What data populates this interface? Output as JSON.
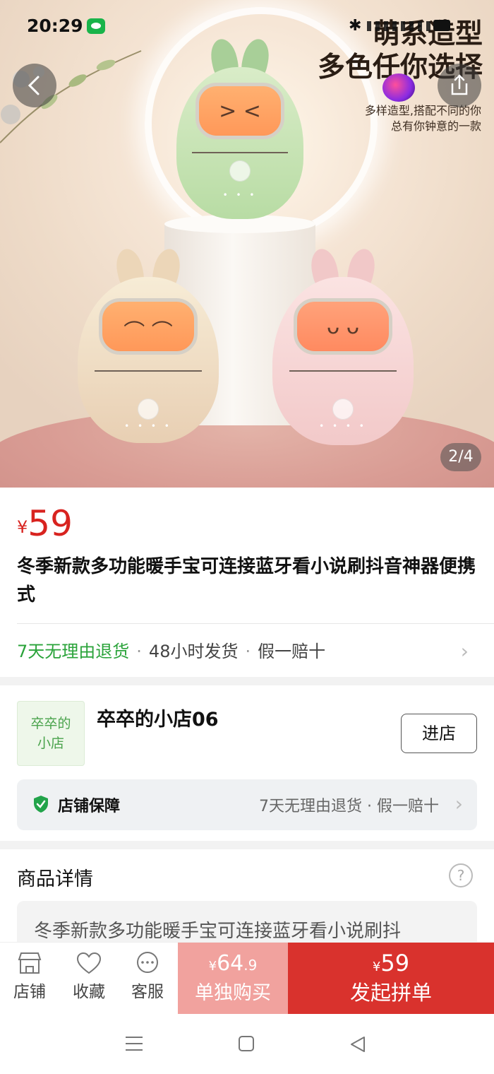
{
  "status_bar": {
    "time": "20:29"
  },
  "hero": {
    "headline_1": "萌系造型",
    "headline_2": "多色任你选择",
    "sub_1": "多样造型,搭配不同的你",
    "sub_2": "总有你钟意的一款",
    "page_indicator": "2/4"
  },
  "product": {
    "currency": "¥",
    "price": "59",
    "title": "冬季新款多功能暖手宝可连接蓝牙看小说刷抖音神器便携式",
    "promise_1": "7天无理由退货",
    "promise_2": "48小时发货",
    "promise_3": "假一赔十"
  },
  "store": {
    "logo_line_1": "卒卒的",
    "logo_line_2": "小店",
    "name": "卒卒的小店06",
    "enter_label": "进店",
    "guarantee_title": "店铺保障",
    "guarantee_text": "7天无理由退货 · 假一赔十"
  },
  "detail": {
    "title": "商品详情",
    "help": "?",
    "preview": "冬季新款多功能暖手宝可连接蓝牙看小说刷抖"
  },
  "bottom_bar": {
    "store_label": "店铺",
    "favorite_label": "收藏",
    "service_label": "客服",
    "single_currency": "¥",
    "single_price_int": "64",
    "single_price_dec": ".9",
    "single_label": "单独购买",
    "group_currency": "¥",
    "group_price": "59",
    "group_label": "发起拼单"
  },
  "colors": {
    "price_red": "#d8231f",
    "promise_green": "#2aa33a",
    "group_buy_red": "#d9322d",
    "single_buy_pink": "#f1a29e"
  }
}
